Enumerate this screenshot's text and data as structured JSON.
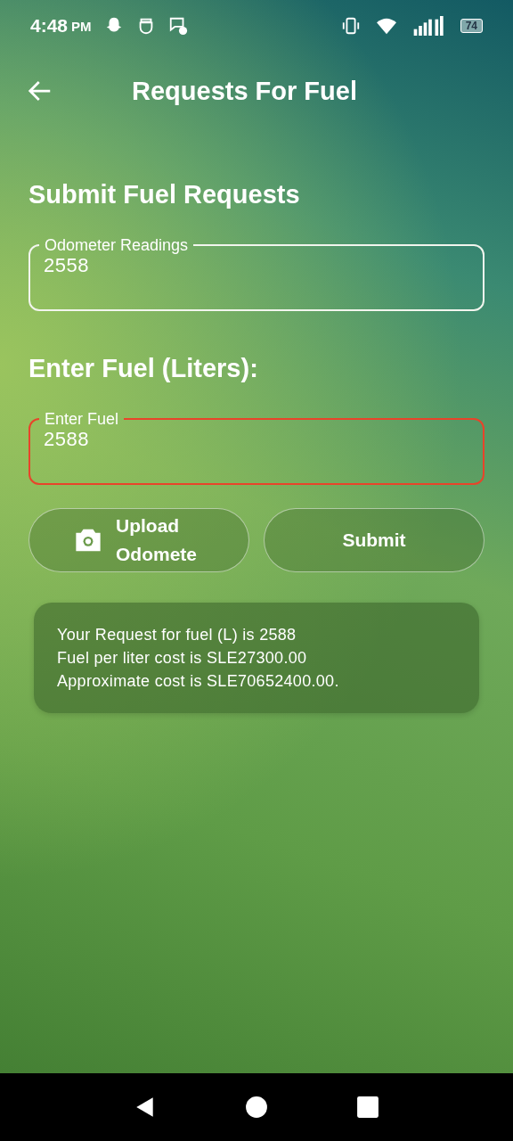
{
  "status_bar": {
    "time": "4:48",
    "meridiem": "PM",
    "battery": "74"
  },
  "app_bar": {
    "title": "Requests For Fuel"
  },
  "sections": [
    {
      "heading": "Submit Fuel Requests",
      "field": {
        "label": "Odometer Readings",
        "value": "2558",
        "error": false
      }
    },
    {
      "heading": "Enter Fuel (Liters):",
      "field": {
        "label": "Enter Fuel",
        "value": "2588",
        "error": true
      }
    }
  ],
  "buttons": [
    {
      "kind": "camera",
      "label": "Upload Odomete"
    },
    {
      "kind": "plain",
      "label": "Submit"
    }
  ],
  "summary": [
    "Your Request for fuel (L) is 2588",
    "Fuel per liter cost is SLE27300.00",
    "Approximate cost is SLE70652400.00."
  ]
}
